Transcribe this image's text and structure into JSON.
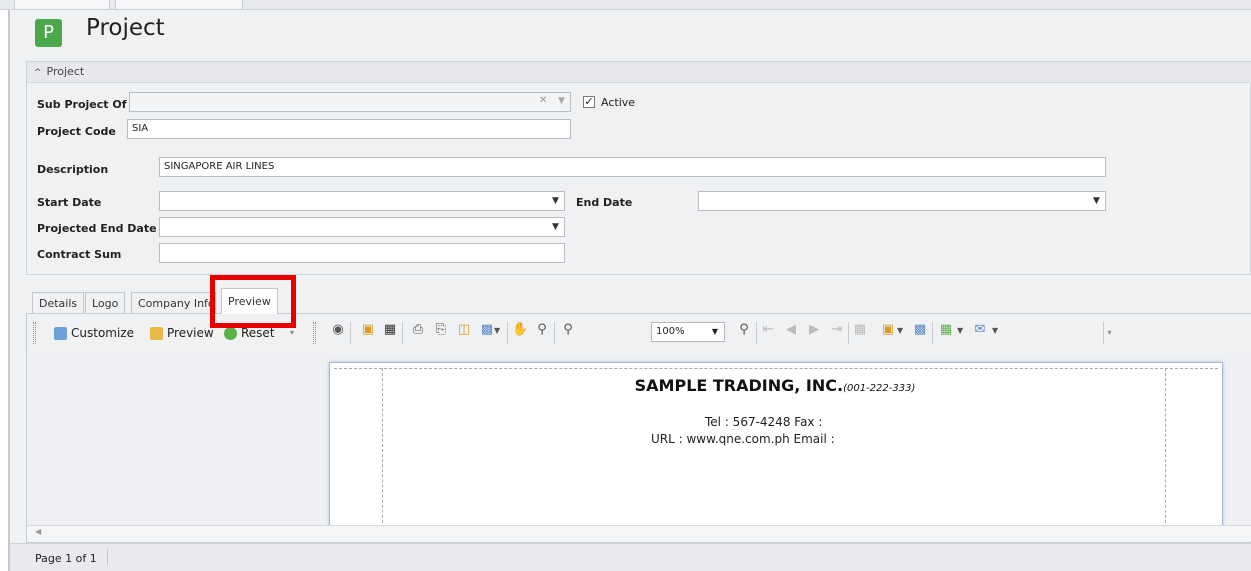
{
  "header": {
    "logo_letter": "P",
    "title": "Project"
  },
  "group": {
    "collapse_icon": "chevron-up-icon",
    "title": "Project"
  },
  "form": {
    "sub_project_label": "Sub Project Of",
    "sub_project_value": "",
    "clear_glyph": "✕",
    "active_label": "Active",
    "active_checked": true,
    "project_code_label": "Project Code",
    "project_code_value": "SIA",
    "description_label": "Description",
    "description_value": "SINGAPORE AIR LINES",
    "start_date_label": "Start Date",
    "start_date_value": "",
    "end_date_label": "End Date",
    "end_date_value": "",
    "projected_end_label": "Projected End Date",
    "projected_end_value": "",
    "contract_sum_label": "Contract Sum",
    "contract_sum_value": ""
  },
  "tabs": [
    {
      "label": "Details"
    },
    {
      "label": "Logo"
    },
    {
      "label": "Company Info"
    },
    {
      "label": "Preview"
    }
  ],
  "active_tab": "Preview",
  "toolbar": {
    "customize_label": "Customize",
    "preview_label": "Preview",
    "reset_label": "Reset",
    "zoom_value": "100%"
  },
  "report": {
    "company_name": "SAMPLE TRADING, INC.",
    "company_reg": "(001-222-333)",
    "tel_line": "Tel : 567-4248  Fax :",
    "url_line": "URL : www.qne.com.ph     Email :"
  },
  "status": {
    "page_info": "Page 1 of 1"
  },
  "colors": {
    "accent_green": "#4aa84b",
    "highlight_red": "#e60000"
  }
}
